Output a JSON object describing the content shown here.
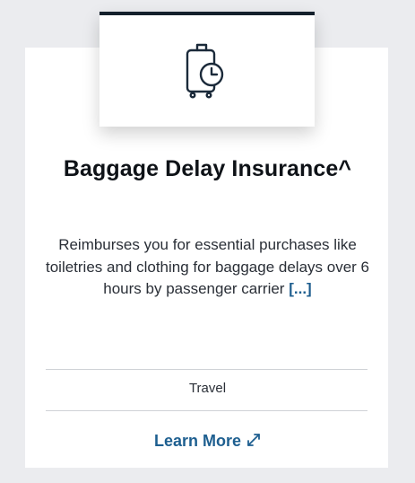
{
  "card": {
    "icon": "luggage-clock-icon",
    "title": "Baggage Delay Insurance^",
    "description": "Reimburses you for essential purchases like toiletries and clothing for baggage delays over 6 hours by passenger carrier",
    "more_link": "[...]",
    "category": "Travel",
    "cta_label": "Learn More",
    "cta_icon": "external-link-icon"
  },
  "colors": {
    "page_background": "#ebecef",
    "card_background": "#ffffff",
    "accent_bar": "#14202c",
    "link": "#1e5f90",
    "icon_stroke": "#1b2a3a"
  }
}
